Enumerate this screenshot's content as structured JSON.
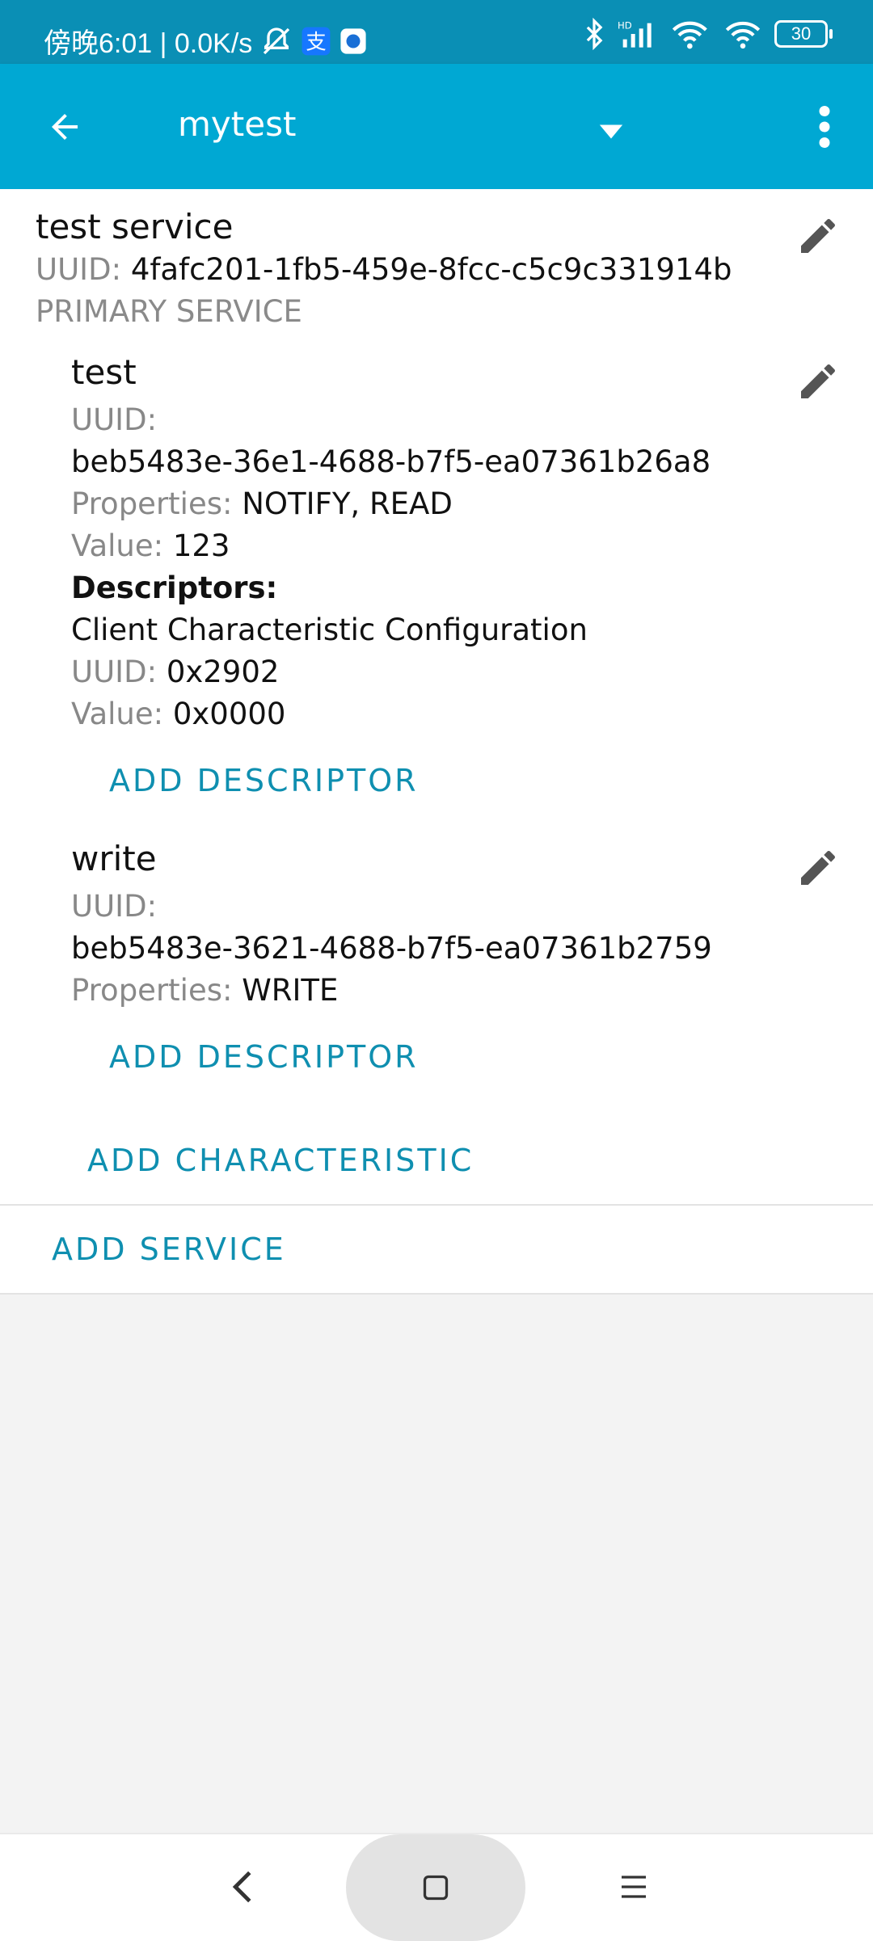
{
  "status_bar": {
    "time": "傍晚6:01 | 0.0K/s",
    "battery": "30",
    "icons": [
      "mute-icon",
      "alipay-icon",
      "app-icon",
      "bluetooth-icon",
      "signal-hd-icon",
      "wifi-link-icon",
      "wifi-icon",
      "battery-icon"
    ]
  },
  "app_bar": {
    "title": "mytest",
    "icons": [
      "back-arrow-icon",
      "dropdown-triangle-icon",
      "more-vert-icon"
    ],
    "color": "#00a8d3"
  },
  "service": {
    "name": "test service",
    "uuid_label": "UUID:",
    "uuid": "4fafc201-1fb5-459e-8fcc-c5c9c331914b",
    "type": "PRIMARY SERVICE"
  },
  "characteristics": [
    {
      "name": "test",
      "uuid_label": "UUID:",
      "uuid": "beb5483e-36e1-4688-b7f5-ea07361b26a8",
      "properties_label": "Properties:",
      "properties": "NOTIFY, READ",
      "value_label": "Value:",
      "value": "123",
      "descriptors_label": "Descriptors:",
      "descriptor": {
        "name": "Client Characteristic Configuration",
        "uuid_label": "UUID:",
        "uuid": "0x2902",
        "value_label": "Value:",
        "value": "0x0000"
      },
      "add_descriptor_label": "ADD DESCRIPTOR"
    },
    {
      "name": "write",
      "uuid_label": "UUID:",
      "uuid": "beb5483e-3621-4688-b7f5-ea07361b2759",
      "properties_label": "Properties:",
      "properties": "WRITE",
      "add_descriptor_label": "ADD DESCRIPTOR"
    }
  ],
  "add_characteristic_label": "ADD CHARACTERISTIC",
  "add_service_label": "ADD SERVICE",
  "accent_color": "#0f8fb0",
  "nav_bar": {
    "icons": [
      "nav-back-icon",
      "nav-home-icon",
      "nav-recents-icon"
    ]
  }
}
